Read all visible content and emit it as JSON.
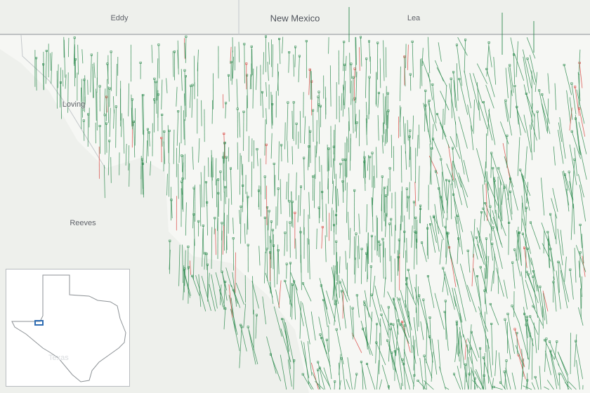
{
  "map": {
    "labels": {
      "state": "New Mexico",
      "eddy": "Eddy",
      "lea": "Lea",
      "loving": "Loving",
      "reeves": "Reeves"
    },
    "colors": {
      "background": "#eef0ec",
      "land": "#f6f7f4",
      "border": "#9fa4a8",
      "active_wells": "#2e8b4f",
      "highlighted_wells": "#d9443f",
      "inset_highlight": "#2f6db3"
    },
    "legend_inset": {
      "label": "Texas",
      "icon": "texas-outline-icon"
    }
  }
}
